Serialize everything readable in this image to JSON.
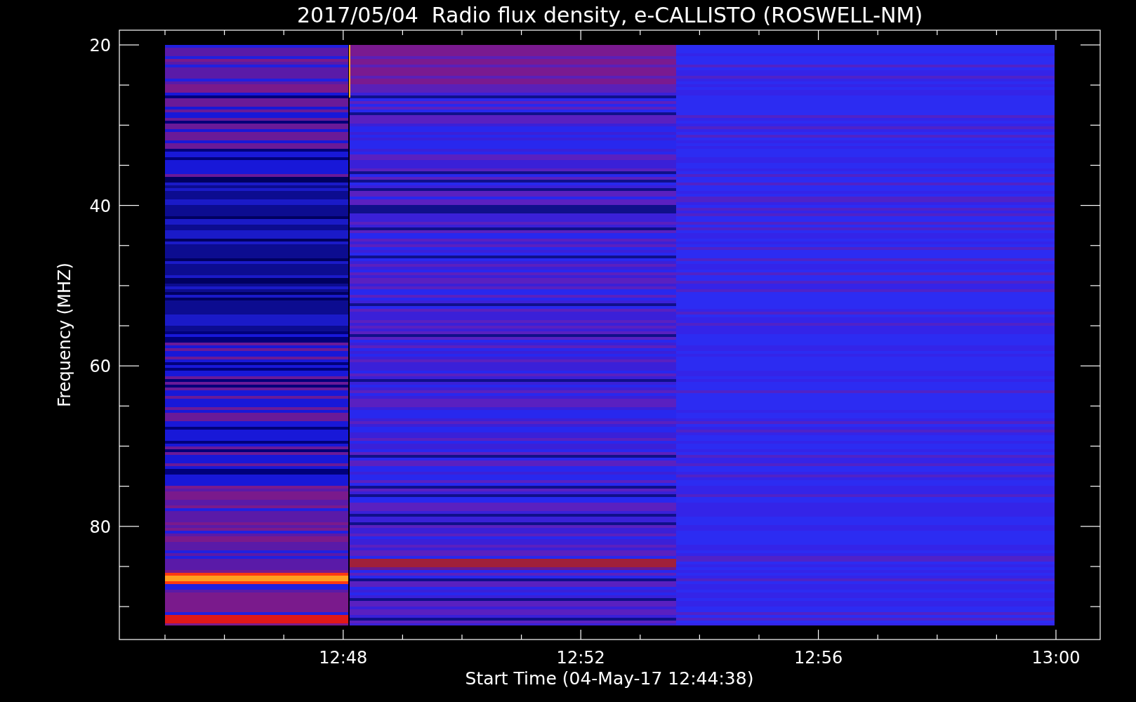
{
  "title": "2017/05/04  Radio flux density, e-CALLISTO (ROSWELL-NM)",
  "y_axis": {
    "label": "Frequency (MHZ)",
    "ticks": [
      "20",
      "40",
      "60",
      "80"
    ]
  },
  "x_axis": {
    "label": "Start Time (04-May-17 12:44:38)",
    "ticks": [
      "12:48",
      "12:52",
      "12:56",
      "13:00"
    ]
  }
}
